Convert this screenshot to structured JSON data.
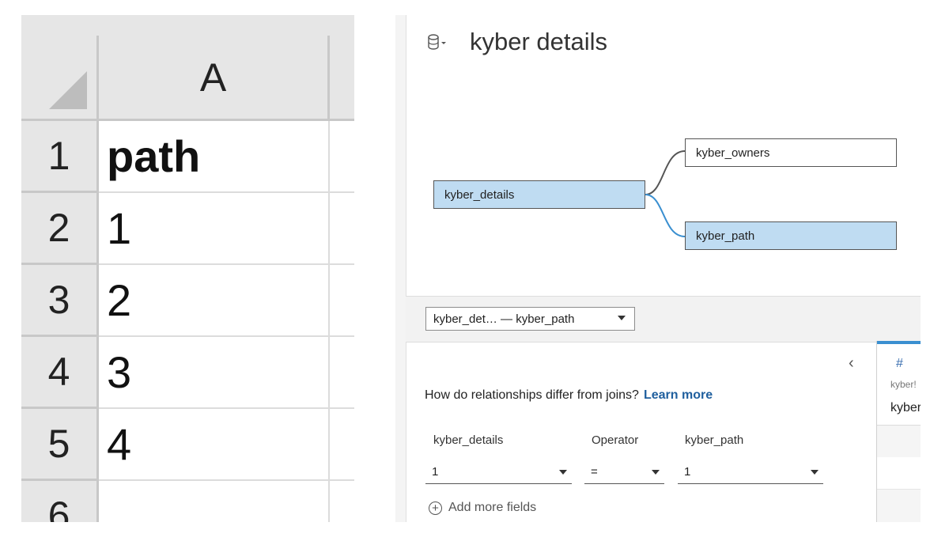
{
  "spreadsheet": {
    "column_header": "A",
    "row_headers": [
      "1",
      "2",
      "3",
      "4",
      "5",
      "6"
    ],
    "cells": [
      "path",
      "1",
      "2",
      "3",
      "4",
      ""
    ]
  },
  "tableau": {
    "datasource_icon": "database-cylinder-icon",
    "title": "kyber details",
    "tables": {
      "root": "kyber_details",
      "owners": "kyber_owners",
      "path": "kyber_path"
    },
    "relationship_dropdown": "kyber_det…  — kyber_path",
    "question": "How do relationships differ from joins?",
    "learn_more": "Learn more",
    "field_labels": {
      "left": "kyber_details",
      "operator": "Operator",
      "right": "kyber_path"
    },
    "field_values": {
      "left": "1",
      "operator": "=",
      "right": "1"
    },
    "add_more_fields": "Add more fields",
    "collapse_glyph": "‹",
    "preview_column": {
      "type_icon": "#",
      "source": "kyber!",
      "name": "kyber"
    },
    "colors": {
      "selected_table": "#bfdcf2",
      "link": "#1f5f9e",
      "relationship_line": "#3a8fd0"
    }
  }
}
